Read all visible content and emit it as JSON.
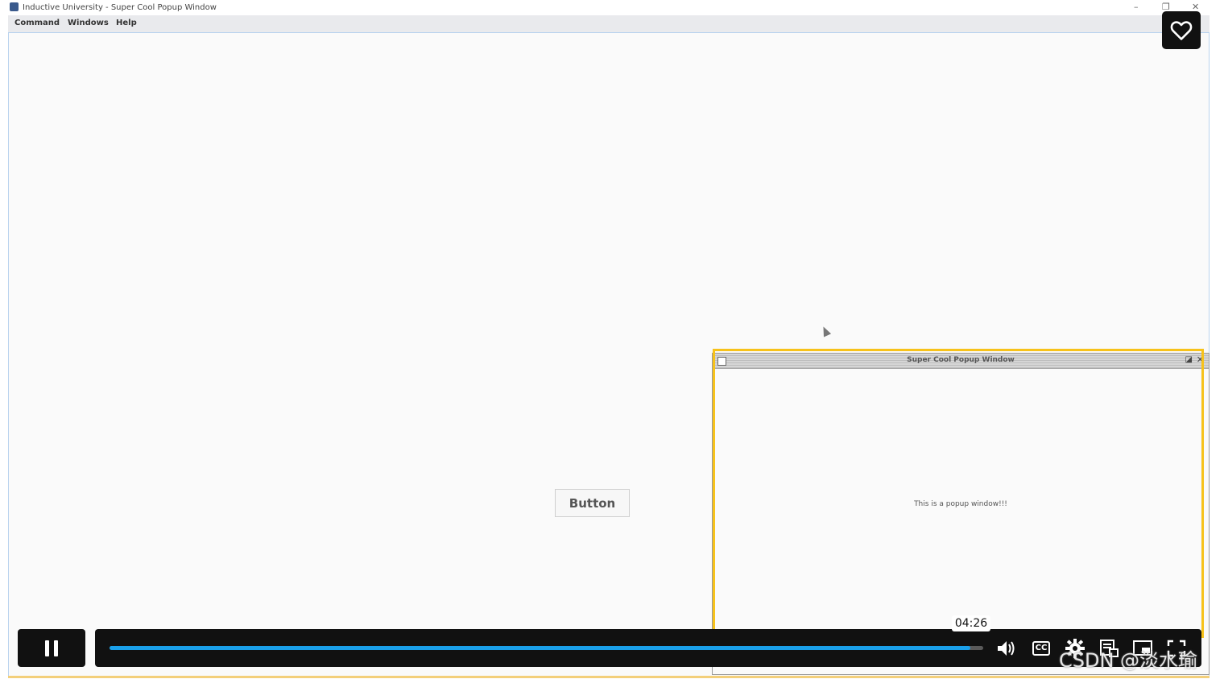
{
  "window": {
    "title": "Inductive University - Super Cool Popup Window",
    "minimize_glyph": "–",
    "maximize_glyph": "❐",
    "close_glyph": "✕"
  },
  "menu": {
    "items": [
      "Command",
      "Windows",
      "Help"
    ]
  },
  "main": {
    "button_label": "Button"
  },
  "popup": {
    "title": "Super Cool Popup Window",
    "message": "This is a popup window!!!"
  },
  "player": {
    "progress": 0.985,
    "time_tooltip": "04:26",
    "cc_label": "CC",
    "icons": [
      "pause-icon",
      "volume-icon",
      "captions-icon",
      "settings-icon",
      "playlist-icon",
      "pip-icon",
      "fullscreen-icon",
      "heart-icon"
    ]
  },
  "colors": {
    "highlight": "#f7c21a",
    "progress_fill": "#1aa0ea",
    "player_bg": "#111111"
  },
  "watermark": "CSDN @淡水瑜"
}
